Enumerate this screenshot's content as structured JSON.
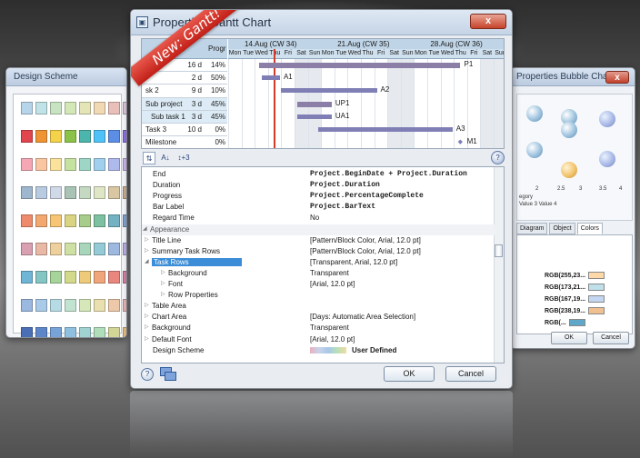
{
  "left_window": {
    "title": "Design Scheme",
    "schemes": [
      [
        "#b7d5ea",
        "#bfe3e6",
        "#c8e3c2",
        "#d3e7b7",
        "#e5e4b7",
        "#f1d9b3",
        "#e8c0b9",
        "#d9c0d6",
        "#c9c6e3",
        "#bcd0ea"
      ],
      [
        "#e1464e",
        "#f09433",
        "#f4d24a",
        "#8bc34a",
        "#4db6ac",
        "#4fc3f7",
        "#5c8ee6",
        "#8e6ee3",
        "#c55cbf",
        "#e0607e"
      ],
      [
        "#f6a7b6",
        "#f9c6a1",
        "#fae19c",
        "#c6e2a0",
        "#9ed6c6",
        "#a0d0ee",
        "#aeb9ec",
        "#cbb0e6",
        "#e6b3d9",
        "#f2b1c3"
      ],
      [
        "#9fb6cf",
        "#b9cbe0",
        "#cfd9e8",
        "#a9c4b6",
        "#c4d8c2",
        "#dfe6c6",
        "#d9c7a4",
        "#c7aa8d",
        "#b39a9a",
        "#a8a0b8"
      ],
      [
        "#ef8b6d",
        "#f3a86f",
        "#f6c675",
        "#d8d481",
        "#a8cc8b",
        "#7dc1a1",
        "#72b2c2",
        "#7f9fcf",
        "#9a8ccc",
        "#c08ac1"
      ],
      [
        "#d8a0b0",
        "#e9b9a6",
        "#eed09e",
        "#cfe0a5",
        "#a9d6bb",
        "#95cbd6",
        "#9fb8e0",
        "#b8aae0",
        "#d2a9d9",
        "#e0a6c3"
      ],
      [
        "#6fb6d6",
        "#84c6c3",
        "#a6d49b",
        "#d2d98a",
        "#eecb7a",
        "#f0a67a",
        "#e9877f",
        "#d17e9f",
        "#a983be",
        "#7f92cb"
      ],
      [
        "#9ab8e0",
        "#a9cae8",
        "#b7dbe4",
        "#c1e3cf",
        "#d6e8b9",
        "#eadfae",
        "#eec9a9",
        "#e5b2b0",
        "#d2a9c6",
        "#b7a9d6"
      ],
      [
        "#4a6fb5",
        "#5d86c8",
        "#78a3d8",
        "#8fc0df",
        "#a0d2d2",
        "#b0ddba",
        "#d3d596",
        "#e3b87d",
        "#d98f72",
        "#c46e6e"
      ]
    ]
  },
  "right_window": {
    "title": "Properties Bubble Chart",
    "axis_ticks": [
      "2",
      "2.5",
      "3",
      "3.5",
      "4"
    ],
    "legend": "Value 3  Value 4",
    "legend_title": "egory",
    "tabs": [
      "Diagram",
      "Object",
      "Colors"
    ],
    "rgb_values": [
      "RGB(255,23...",
      "RGB(173,21...",
      "RGB(167,19...",
      "RGB(238,19...",
      "RGB(..."
    ],
    "rgb_colors": [
      "#ffd8a8",
      "#bfe0ea",
      "#c4d7f2",
      "#f0c090",
      "#5fa7c8"
    ],
    "ok": "OK",
    "cancel": "Cancel"
  },
  "ribbon": "New: Gantt!",
  "main": {
    "title": "Properties Gantt Chart",
    "close": "x",
    "gantt": {
      "progress_header": "Progr",
      "weeks": [
        "14.Aug (CW 34)",
        "21.Aug (CW 35)",
        "28.Aug (CW 36)"
      ],
      "days": [
        "Mon",
        "Tue",
        "Wed",
        "Thu",
        "Fri",
        "Sat",
        "Sun",
        "Mon",
        "Tue",
        "Wed",
        "Thu",
        "Fri",
        "Sat",
        "Sun",
        "Mon",
        "Tue",
        "Wed",
        "Thu",
        "Fri",
        "Sat",
        "Sun"
      ],
      "rows": [
        {
          "name": "",
          "duration": "16 d",
          "progress": "14%"
        },
        {
          "name": "",
          "duration": "2 d",
          "progress": "50%"
        },
        {
          "name": "sk 2",
          "duration": "9 d",
          "progress": "10%"
        },
        {
          "name": "Sub project",
          "duration": "3 d",
          "progress": "45%"
        },
        {
          "name": "Sub task 1",
          "duration": "3 d",
          "progress": "45%"
        },
        {
          "name": "Task 3",
          "duration": "10 d",
          "progress": "0%"
        },
        {
          "name": "Milestone",
          "duration": "",
          "progress": "0%"
        }
      ],
      "bar_labels": [
        "P1",
        "A1",
        "A2",
        "UP1",
        "UA1",
        "A3",
        "M1"
      ]
    },
    "toolbar": {
      "sort_icon": "⇅",
      "sort_az": "A↓",
      "extra": "↕+3",
      "help": "?"
    },
    "properties": [
      {
        "key": "End",
        "value": "Project.BeginDate + Project.Duration",
        "bold": true
      },
      {
        "key": "Duration",
        "value": "Project.Duration",
        "bold": true
      },
      {
        "key": "Progress",
        "value": "Project.PercentageComplete",
        "bold": true
      },
      {
        "key": "Bar Label",
        "value": "Project.BarText",
        "bold": true
      },
      {
        "key": "Regard Time",
        "value": "No",
        "bold": false
      },
      {
        "key": "Appearance",
        "value": "",
        "category": true
      },
      {
        "key": "Title Line",
        "value": "[Pattern/Block Color, Arial, 12.0 pt]",
        "expand": true
      },
      {
        "key": "Summary Task Rows",
        "value": "[Pattern/Block Color, Arial, 12.0 pt]",
        "expand": true
      },
      {
        "key": "Task Rows",
        "value": "[Transparent, Arial, 12.0 pt]",
        "selected": true,
        "expanded": true
      },
      {
        "key": "Background",
        "value": "Transparent",
        "indent": 2,
        "expand": true
      },
      {
        "key": "Font",
        "value": "[Arial, 12.0 pt]",
        "indent": 2,
        "expand": true
      },
      {
        "key": "Row Properties",
        "value": "",
        "indent": 2,
        "expand": true
      },
      {
        "key": "Table Area",
        "value": "",
        "expand": true
      },
      {
        "key": "Chart Area",
        "value": "[Days: Automatic Area Selection]",
        "expand": true
      },
      {
        "key": "Background",
        "value": "Transparent",
        "expand": true
      },
      {
        "key": "Default Font",
        "value": "[Arial, 12.0 pt]",
        "expand": true
      },
      {
        "key": "Design Scheme",
        "value": "User Defined",
        "scheme": true
      }
    ],
    "ok": "OK",
    "cancel": "Cancel",
    "help_icon": "?"
  }
}
